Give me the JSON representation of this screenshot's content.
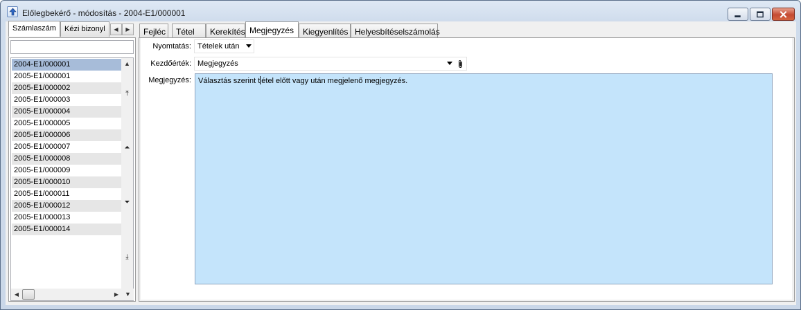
{
  "window": {
    "title": "Előlegbekérő - módosítás - 2004-E1/000001"
  },
  "left": {
    "tabs": [
      {
        "label": "Számlaszám",
        "active": true
      },
      {
        "label": "Kézi bizonyl",
        "active": false
      }
    ],
    "search_value": "",
    "items": [
      {
        "label": "2004-E1/000001",
        "selected": true
      },
      {
        "label": "2005-E1/000001"
      },
      {
        "label": "2005-E1/000002"
      },
      {
        "label": "2005-E1/000003"
      },
      {
        "label": "2005-E1/000004"
      },
      {
        "label": "2005-E1/000005"
      },
      {
        "label": "2005-E1/000006"
      },
      {
        "label": "2005-E1/000007"
      },
      {
        "label": "2005-E1/000008"
      },
      {
        "label": "2005-E1/000009"
      },
      {
        "label": "2005-E1/000010"
      },
      {
        "label": "2005-E1/000011"
      },
      {
        "label": "2005-E1/000012"
      },
      {
        "label": "2005-E1/000013"
      },
      {
        "label": "2005-E1/000014"
      }
    ]
  },
  "tabs": [
    {
      "label": "Fejléc"
    },
    {
      "label": "Tétel"
    },
    {
      "label": "Kerekítés"
    },
    {
      "label": "Megjegyzés",
      "active": true
    },
    {
      "label": "Kiegyenlítés"
    },
    {
      "label": "Helyesbítéselszámolás"
    }
  ],
  "form": {
    "nyomtatas_label": "Nyomtatás:",
    "nyomtatas_value": "Tételek után",
    "kezdoertek_label": "Kezdőérték:",
    "kezdoertek_value": "Megjegyzés",
    "megjegyzes_label": "Megjegyzés:",
    "megjegyzes_text_before": "Választás szerint t",
    "megjegyzes_text_after": "étel előtt vagy után megjelenő megjegyzés."
  },
  "colors": {
    "selected_row": "#a7bcd9",
    "alt_row": "#e6e6e6",
    "note_background": "#c4e4fb",
    "close_button": "#c44a32"
  }
}
